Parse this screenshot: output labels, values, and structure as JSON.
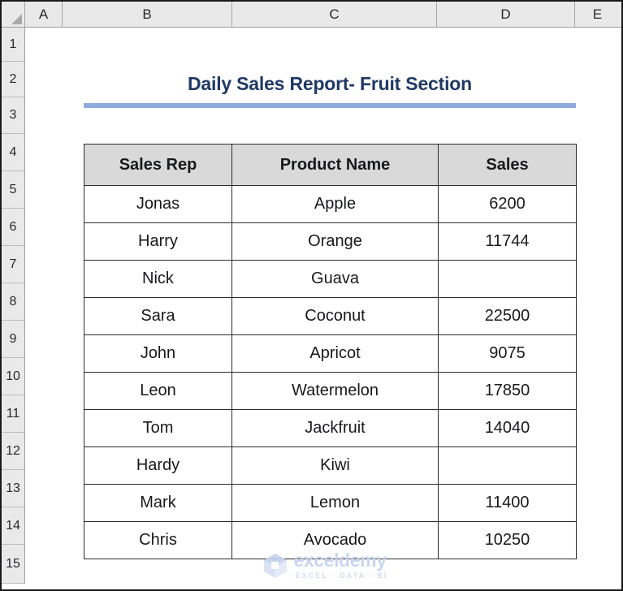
{
  "spreadsheet": {
    "select_all_icon": "select-all-triangle-icon",
    "columns": [
      {
        "label": "A"
      },
      {
        "label": "B"
      },
      {
        "label": "C"
      },
      {
        "label": "D"
      },
      {
        "label": "E"
      }
    ],
    "rows": [
      {
        "label": "1"
      },
      {
        "label": "2"
      },
      {
        "label": "3"
      },
      {
        "label": "4"
      },
      {
        "label": "5"
      },
      {
        "label": "6"
      },
      {
        "label": "7"
      },
      {
        "label": "8"
      },
      {
        "label": "9"
      },
      {
        "label": "10"
      },
      {
        "label": "11"
      },
      {
        "label": "12"
      },
      {
        "label": "13"
      },
      {
        "label": "14"
      },
      {
        "label": "15"
      }
    ]
  },
  "report": {
    "title": "Daily Sales Report- Fruit Section",
    "title_color": "#1F3864",
    "underline_color": "#8FAADC"
  },
  "table": {
    "header_fill": "#D9D9D9",
    "border_color": "#2B2B2B",
    "headers": [
      "Sales Rep",
      "Product Name",
      "Sales"
    ],
    "rows": [
      {
        "sales_rep": "Jonas",
        "product_name": "Apple",
        "sales": "6200"
      },
      {
        "sales_rep": "Harry",
        "product_name": "Orange",
        "sales": "11744"
      },
      {
        "sales_rep": "Nick",
        "product_name": "Guava",
        "sales": ""
      },
      {
        "sales_rep": "Sara",
        "product_name": "Coconut",
        "sales": "22500"
      },
      {
        "sales_rep": "John",
        "product_name": "Apricot",
        "sales": "9075"
      },
      {
        "sales_rep": "Leon",
        "product_name": "Watermelon",
        "sales": "17850"
      },
      {
        "sales_rep": "Tom",
        "product_name": "Jackfruit",
        "sales": "14040"
      },
      {
        "sales_rep": "Hardy",
        "product_name": "Kiwi",
        "sales": ""
      },
      {
        "sales_rep": "Mark",
        "product_name": "Lemon",
        "sales": "11400"
      },
      {
        "sales_rep": "Chris",
        "product_name": "Avocado",
        "sales": "10250"
      }
    ]
  },
  "watermark": {
    "logo_icon": "exceldemy-cube-logo-icon",
    "name": "exceldemy",
    "tagline": "EXCEL - DATA - BI",
    "color": "#C3D2EE"
  }
}
